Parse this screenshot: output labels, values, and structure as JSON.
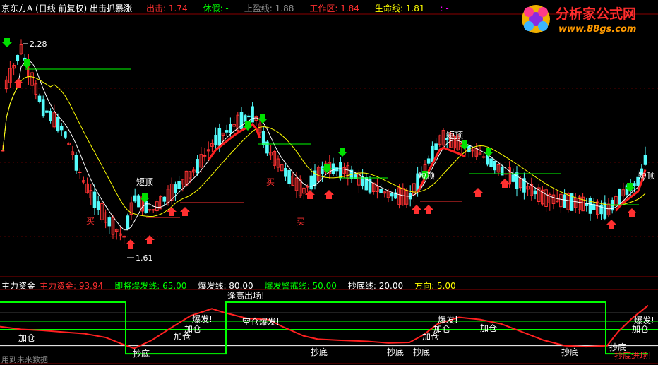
{
  "header": {
    "stock": "京东方A",
    "period": "(日线 前复权)",
    "formula": "出击抓暴涨",
    "items": [
      {
        "label": "出击:",
        "value": "1.74",
        "color": "#ff3030"
      },
      {
        "label": "休假:",
        "value": "-",
        "color": "#00ff00"
      },
      {
        "label": "止盈线:",
        "value": "1.88",
        "color": "#909090"
      },
      {
        "label": "工作区:",
        "value": "1.84",
        "color": "#ff3030"
      },
      {
        "label": "生命线:",
        "value": "1.81",
        "color": "#ffff00"
      },
      {
        "label": ":",
        "value": "-",
        "color": "#ff00ff"
      }
    ]
  },
  "logo": {
    "title": "分析家公式网",
    "url": "www.88gs.com"
  },
  "sub_header": {
    "name": "主力资金",
    "items": [
      {
        "label": "主力资金:",
        "value": "93.94",
        "color": "#ff3030"
      },
      {
        "label": "即将爆发线:",
        "value": "65.00",
        "color": "#00ff00"
      },
      {
        "label": "爆发线:",
        "value": "80.00",
        "color": "#ffffff"
      },
      {
        "label": "爆发警戒线:",
        "value": "50.00",
        "color": "#00ff00"
      },
      {
        "label": "抄底线:",
        "value": "20.00",
        "color": "#ffffff"
      },
      {
        "label": "方向:",
        "value": "5.00",
        "color": "#ffff00"
      }
    ]
  },
  "footer": "用到未来数据",
  "colors": {
    "up": "#ff3232",
    "down": "#54fcfc",
    "ma_fast": "#ffff00",
    "ma_slow": "#ffffff",
    "work": "#ff2020",
    "sub_line": "#ff2020",
    "direction": "#00ff00"
  },
  "chart_data": [
    {
      "type": "candlestick",
      "panel": "main",
      "price_annotations": [
        {
          "label": "2.28"
        },
        {
          "label": "1.61"
        }
      ],
      "signal_labels": [
        "短顶",
        "短顶",
        "短顶",
        "短顶",
        "买",
        "买",
        "买"
      ],
      "ylim": [
        1.55,
        2.32
      ],
      "points": [
        {
          "x": 6,
          "y": 2.1
        },
        {
          "x": 30,
          "y": 2.22
        },
        {
          "x": 60,
          "y": 2.05
        },
        {
          "x": 90,
          "y": 1.98
        },
        {
          "x": 120,
          "y": 1.82
        },
        {
          "x": 150,
          "y": 1.72
        },
        {
          "x": 175,
          "y": 1.66
        },
        {
          "x": 190,
          "y": 1.78
        },
        {
          "x": 215,
          "y": 1.74
        },
        {
          "x": 245,
          "y": 1.8
        },
        {
          "x": 275,
          "y": 1.86
        },
        {
          "x": 305,
          "y": 1.95
        },
        {
          "x": 335,
          "y": 2.0
        },
        {
          "x": 360,
          "y": 2.03
        },
        {
          "x": 380,
          "y": 1.92
        },
        {
          "x": 410,
          "y": 1.84
        },
        {
          "x": 430,
          "y": 1.8
        },
        {
          "x": 460,
          "y": 1.87
        },
        {
          "x": 490,
          "y": 1.86
        },
        {
          "x": 520,
          "y": 1.82
        },
        {
          "x": 550,
          "y": 1.79
        },
        {
          "x": 580,
          "y": 1.78
        },
        {
          "x": 600,
          "y": 1.86
        },
        {
          "x": 625,
          "y": 1.96
        },
        {
          "x": 650,
          "y": 1.94
        },
        {
          "x": 680,
          "y": 1.91
        },
        {
          "x": 710,
          "y": 1.86
        },
        {
          "x": 740,
          "y": 1.82
        },
        {
          "x": 770,
          "y": 1.78
        },
        {
          "x": 800,
          "y": 1.77
        },
        {
          "x": 830,
          "y": 1.76
        },
        {
          "x": 860,
          "y": 1.74
        },
        {
          "x": 880,
          "y": 1.79
        },
        {
          "x": 905,
          "y": 1.83
        },
        {
          "x": 918,
          "y": 1.92
        }
      ]
    },
    {
      "type": "line",
      "panel": "sub",
      "ylim": [
        0,
        100
      ],
      "series": [
        {
          "name": "主力资金",
          "values": [
            [
              0,
              55
            ],
            [
              30,
              50
            ],
            [
              60,
              48
            ],
            [
              90,
              45
            ],
            [
              120,
              42
            ],
            [
              150,
              35
            ],
            [
              175,
              22
            ],
            [
              190,
              15
            ],
            [
              215,
              30
            ],
            [
              245,
              55
            ],
            [
              270,
              75
            ],
            [
              300,
              88
            ],
            [
              320,
              80
            ],
            [
              350,
              70
            ],
            [
              380,
              68
            ],
            [
              400,
              55
            ],
            [
              430,
              38
            ],
            [
              450,
              32
            ],
            [
              480,
              30
            ],
            [
              520,
              28
            ],
            [
              550,
              25
            ],
            [
              580,
              26
            ],
            [
              600,
              40
            ],
            [
              620,
              60
            ],
            [
              650,
              72
            ],
            [
              680,
              68
            ],
            [
              710,
              60
            ],
            [
              740,
              45
            ],
            [
              770,
              30
            ],
            [
              800,
              20
            ],
            [
              830,
              18
            ],
            [
              860,
              20
            ],
            [
              875,
              45
            ],
            [
              895,
              70
            ],
            [
              918,
              93.94
            ]
          ]
        },
        {
          "name": "方向",
          "values": [
            [
              0,
              100
            ],
            [
              178,
              100
            ],
            [
              178,
              5
            ],
            [
              320,
              5
            ],
            [
              320,
              100
            ],
            [
              858,
              100
            ],
            [
              858,
              5
            ],
            [
              918,
              5
            ]
          ]
        }
      ],
      "levels": [
        {
          "name": "爆发线",
          "value": 80
        },
        {
          "name": "即将爆发线",
          "value": 65
        },
        {
          "name": "爆发警戒线",
          "value": 50
        },
        {
          "name": "抄底线",
          "value": 20
        }
      ],
      "signal_labels": [
        "逢高出场!",
        "加仓",
        "加仓",
        "加仓",
        "加仓",
        "加仓",
        "加仓",
        "加仓",
        "爆发!",
        "爆发!",
        "爆发!",
        "空仓爆发!",
        "抄底",
        "抄底",
        "抄底",
        "抄底",
        "抄底",
        "抄底",
        "抄底进场!"
      ]
    }
  ]
}
